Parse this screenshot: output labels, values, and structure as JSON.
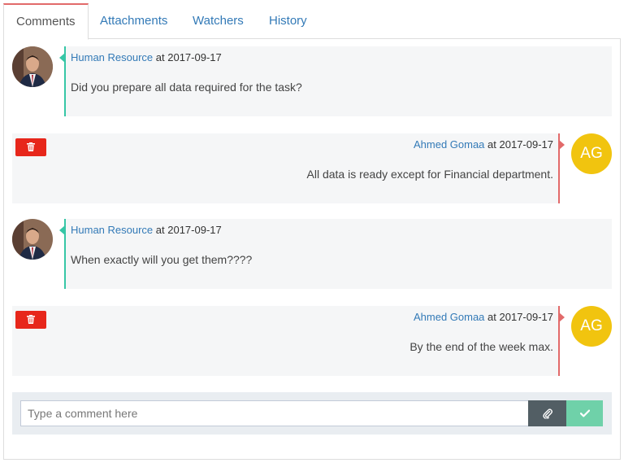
{
  "tabs": [
    {
      "label": "Comments",
      "active": true
    },
    {
      "label": "Attachments",
      "active": false
    },
    {
      "label": "Watchers",
      "active": false
    },
    {
      "label": "History",
      "active": false
    }
  ],
  "comments": [
    {
      "author": "Human Resource",
      "at": "at 2017-09-17",
      "text": "Did you prepare all data required for the task?",
      "side": "incoming",
      "avatar": "photo"
    },
    {
      "author": "Ahmed Gomaa",
      "at": "at 2017-09-17",
      "text": "All data is ready except for Financial department.",
      "side": "outgoing",
      "avatar_initials": "AG",
      "delete_icon": "trash-icon"
    },
    {
      "author": "Human Resource",
      "at": "at 2017-09-17",
      "text": "When exactly will you get them????",
      "side": "incoming",
      "avatar": "photo"
    },
    {
      "author": "Ahmed Gomaa",
      "at": "at 2017-09-17",
      "text": "By the end of the week max.",
      "side": "outgoing",
      "avatar_initials": "AG",
      "delete_icon": "trash-icon"
    }
  ],
  "composer": {
    "placeholder": "Type a comment here",
    "attach_icon": "paperclip-icon",
    "send_icon": "check-icon"
  },
  "colors": {
    "incoming_accent": "#36c6a6",
    "outgoing_accent": "#e26a6a",
    "initials_avatar": "#f1c40f",
    "delete_button": "#e7271b",
    "send_button": "#6fd1a9",
    "attach_button": "#525e64"
  }
}
